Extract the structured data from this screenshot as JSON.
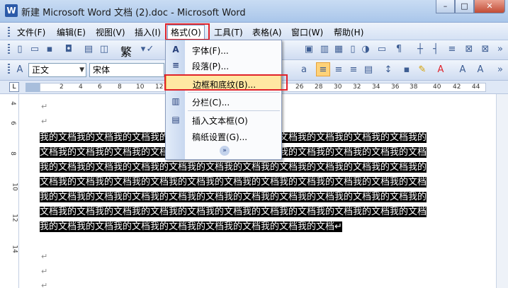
{
  "window": {
    "title": "新建 Microsoft Word 文档 (2).doc - Microsoft Word",
    "minimize": "–",
    "maximize": "□",
    "close": "✕"
  },
  "menubar": {
    "items": [
      "文件(F)",
      "编辑(E)",
      "视图(V)",
      "插入(I)",
      "格式(O)",
      "工具(T)",
      "表格(A)",
      "窗口(W)",
      "帮助(H)"
    ]
  },
  "toolbar": {
    "traditional_label": "繁",
    "style_value": "正文",
    "font_value": "宋体"
  },
  "ruler": {
    "corner": "L",
    "numbers": [
      "2",
      "4",
      "6",
      "8",
      "10",
      "12",
      "26",
      "28",
      "30",
      "32",
      "34",
      "36",
      "38",
      "40",
      "42",
      "44"
    ],
    "vertical_numbers": [
      "4",
      "6",
      "8",
      "10",
      "12",
      "14"
    ]
  },
  "format_menu": {
    "items": [
      {
        "icon": "A",
        "label": "字体(F)..."
      },
      {
        "icon": "≡",
        "label": "段落(P)..."
      },
      {
        "icon": "",
        "label": "边框和底纹(B)..."
      },
      {
        "icon": "▥",
        "label": "分栏(C)..."
      },
      {
        "icon": "▤",
        "label": "插入文本框(O)"
      },
      {
        "icon": "",
        "label": "稿纸设置(G)..."
      }
    ],
    "expand": "»"
  },
  "document": {
    "paragraph_mark": "↵",
    "selected_text": "我的文档我的文档我的文档我的文档我的文档我的文档我的文档我的文档我的文档我的文档我的文档我的文档我的文档我的文档我的文档我的文档我的文档我的文档我的文档我的文档我的文档我的文档我的文档我的文档我的文档我的文档我的文档我的文档我的文档我的文档我的文档我的文档我的文档我的文档我的文档我的文档我的文档我的文档我的文档我的文档我的文档我的文档我的文档我的文档我的文档我的文档我的文档我的文档我的文档我的文档我的文档我的文档我的文档我的文档我的文档我的文档我的文档我的文档我的文档我的文档我的文档我的文档我的文档我的文档我的文档我的文档我的文档我的文档我的文档我的文档我的文档"
  },
  "colors": {
    "highlight_red": "#e0222a",
    "menu_hover": "#ffe7a2",
    "selection": "#000000"
  }
}
